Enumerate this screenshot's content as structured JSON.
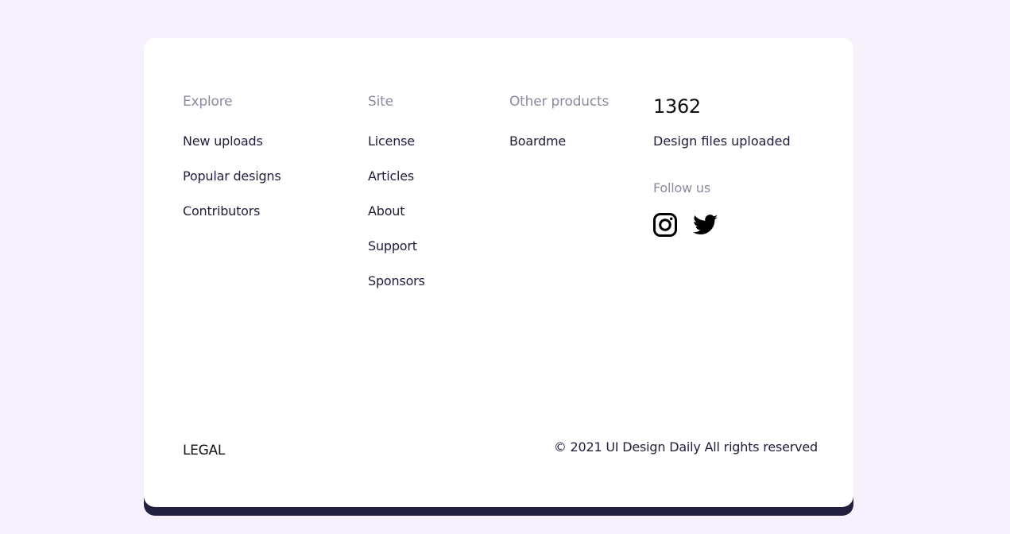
{
  "colors": {
    "page_background": "#f7f0fd",
    "card_background": "#ffffff",
    "card_shadow": "#23203f",
    "heading_muted": "#8a8aa0",
    "link_text": "#1f1d3a"
  },
  "footer": {
    "explore": {
      "heading": "Explore",
      "links": [
        "New uploads",
        "Popular designs",
        "Contributors"
      ]
    },
    "site": {
      "heading": "Site",
      "links": [
        "License",
        "Articles",
        "About",
        "Support",
        "Sponsors"
      ]
    },
    "products": {
      "heading": "Other products",
      "links": [
        "Boardme"
      ]
    },
    "stats": {
      "count": "1362",
      "label": "Design files uploaded",
      "follow_heading": "Follow us",
      "social": [
        {
          "icon": "instagram-icon"
        },
        {
          "icon": "twitter-icon"
        }
      ]
    },
    "legal_label": "LEGAL",
    "copyright": "© 2021 UI Design Daily All rights reserved"
  }
}
